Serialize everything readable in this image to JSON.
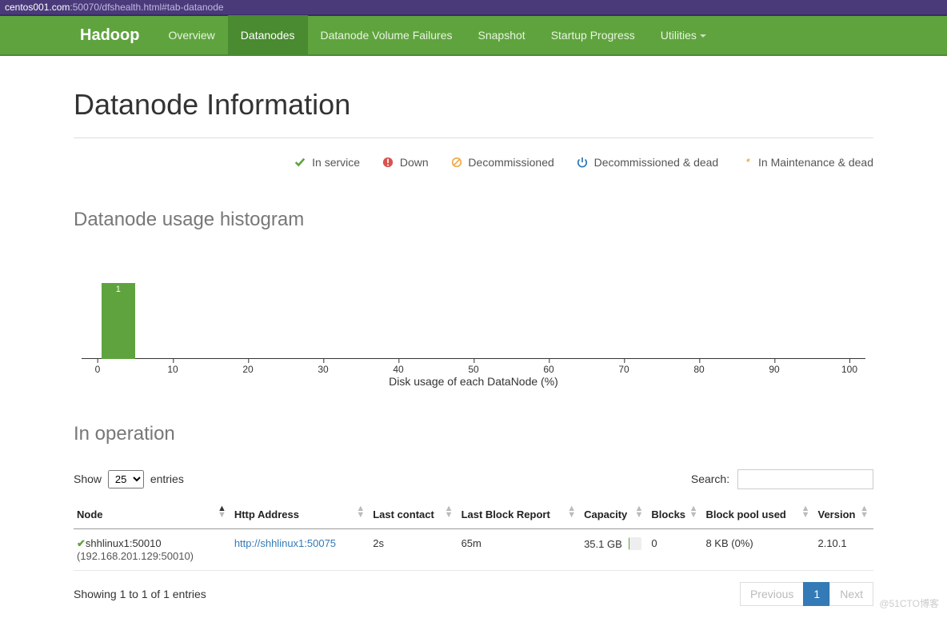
{
  "url": {
    "host": "centos001.com",
    "path": ":50070/dfshealth.html#tab-datanode"
  },
  "nav": {
    "brand": "Hadoop",
    "items": [
      "Overview",
      "Datanodes",
      "Datanode Volume Failures",
      "Snapshot",
      "Startup Progress",
      "Utilities"
    ],
    "active_index": 1
  },
  "page_title": "Datanode Information",
  "legend": {
    "in_service": "In service",
    "down": "Down",
    "decommissioned": "Decommissioned",
    "decommissioned_dead": "Decommissioned & dead",
    "in_maintenance_dead": "In Maintenance & dead"
  },
  "histogram_heading": "Datanode usage histogram",
  "in_operation_heading": "In operation",
  "chart_data": {
    "type": "bar",
    "title": "Datanode usage histogram",
    "xlabel": "Disk usage of each DataNode (%)",
    "ylabel": "",
    "xlim": [
      0,
      100
    ],
    "bins": [
      0,
      10,
      20,
      30,
      40,
      50,
      60,
      70,
      80,
      90,
      100
    ],
    "counts": [
      1,
      0,
      0,
      0,
      0,
      0,
      0,
      0,
      0,
      0
    ],
    "tick_labels": [
      "0",
      "10",
      "20",
      "30",
      "40",
      "50",
      "60",
      "70",
      "80",
      "90",
      "100"
    ]
  },
  "datatable": {
    "show_label_pre": "Show",
    "show_label_post": "entries",
    "page_size": "25",
    "search_label": "Search:",
    "columns": [
      "Node",
      "Http Address",
      "Last contact",
      "Last Block Report",
      "Capacity",
      "Blocks",
      "Block pool used",
      "Version"
    ],
    "rows": [
      {
        "node_name": "shhlinux1:50010",
        "node_addr": "(192.168.201.129:50010)",
        "http_address": "http://shhlinux1:50075",
        "last_contact": "2s",
        "last_block_report": "65m",
        "capacity_text": "35.1 GB",
        "capacity_pct": 4,
        "blocks": "0",
        "block_pool_used": "8 KB (0%)",
        "version": "2.10.1"
      }
    ],
    "info": "Showing 1 to 1 of 1 entries",
    "pager": {
      "prev": "Previous",
      "pages": [
        "1"
      ],
      "next": "Next",
      "active": 0
    }
  },
  "watermark": "@51CTO博客"
}
